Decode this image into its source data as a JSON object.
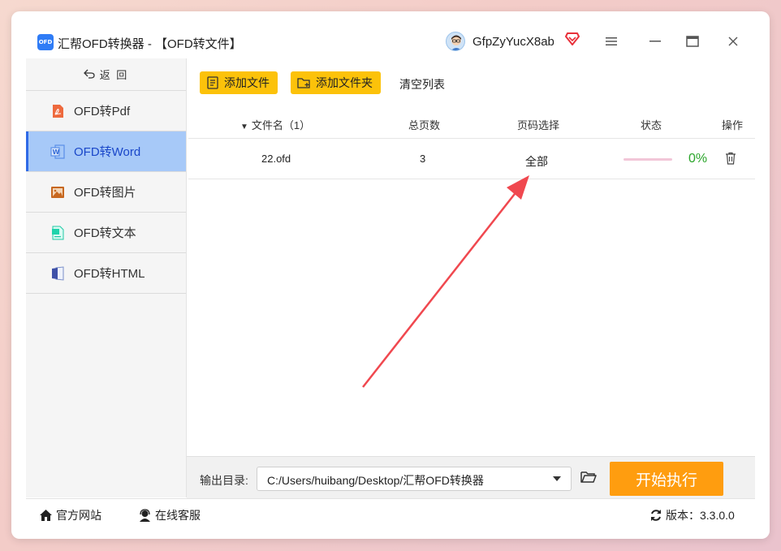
{
  "window": {
    "logo_text": "OFD",
    "title": "汇帮OFD转换器 - 【OFD转文件】",
    "username": "GfpZyYucX8ab"
  },
  "sidebar": {
    "back_label": "返 回",
    "items": [
      {
        "label": "OFD转Pdf",
        "icon": "pdf-icon",
        "active": false
      },
      {
        "label": "OFD转Word",
        "icon": "word-icon",
        "active": true
      },
      {
        "label": "OFD转图片",
        "icon": "image-icon",
        "active": false
      },
      {
        "label": "OFD转文本",
        "icon": "text-icon",
        "active": false
      },
      {
        "label": "OFD转HTML",
        "icon": "html-icon",
        "active": false
      }
    ]
  },
  "toolbar": {
    "add_file": "添加文件",
    "add_folder": "添加文件夹",
    "clear_list": "清空列表"
  },
  "table": {
    "headers": {
      "name": "文件名（1）",
      "pages": "总页数",
      "range": "页码选择",
      "status": "状态",
      "ops": "操作"
    },
    "rows": [
      {
        "name": "22.ofd",
        "pages": "3",
        "range": "全部",
        "progress": 0,
        "percent": "0%"
      }
    ]
  },
  "output": {
    "label": "输出目录:",
    "path": "C:/Users/huibang/Desktop/汇帮OFD转换器",
    "start_button": "开始执行"
  },
  "footer": {
    "website": "官方网站",
    "service": "在线客服",
    "version": "版本：3.3.0.0"
  },
  "colors": {
    "accent_yellow": "#fcc20a",
    "start_orange": "#ff9d0f",
    "active_nav": "#a7c9f8",
    "annotation_arrow": "#f0484f"
  }
}
